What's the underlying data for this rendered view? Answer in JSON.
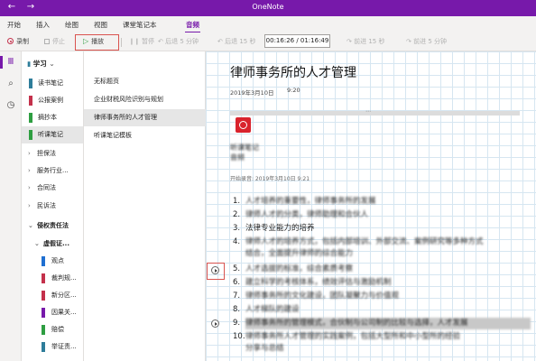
{
  "window": {
    "title": "OneNote",
    "back_glyph": "←",
    "forward_glyph": "→",
    "accent": "#7719aa"
  },
  "ribbon": {
    "tabs": [
      "开始",
      "插入",
      "绘图",
      "视图",
      "课堂笔记本",
      "音频"
    ],
    "active_tab": "音频"
  },
  "audio_bar": {
    "record": "录制",
    "stop": "停止",
    "play": "播放",
    "pause": "暂停",
    "rewind_5min": "后退 5 分钟",
    "rewind_15s": "后退 15 秒",
    "time": "00:16:26 / 01:16:49",
    "forward_15s": "前进 15 秒",
    "forward_5min": "前进 5 分钟"
  },
  "notebook": {
    "name": "学习",
    "sections": [
      {
        "label": "读书笔记",
        "color": "#2e7d9a"
      },
      {
        "label": "公报案例",
        "color": "#c4314b"
      },
      {
        "label": "摘抄本",
        "color": "#2e9e41"
      },
      {
        "label": "听课笔记",
        "color": "#2e9e41"
      }
    ],
    "groups_collapsed": [
      "担保法",
      "服务行业...",
      "合同法",
      "民诉法"
    ],
    "group_expanded": "侵权责任法",
    "subgroup": "虚假证...",
    "subsections": [
      {
        "label": "观点",
        "color": "#1f6fd1"
      },
      {
        "label": "裁判规...",
        "color": "#c4314b"
      },
      {
        "label": "新分区...",
        "color": "#c4314b"
      },
      {
        "label": "因果关...",
        "color": "#7719aa"
      },
      {
        "label": "赔偿",
        "color": "#2e9e41"
      },
      {
        "label": "举证责...",
        "color": "#2e7d9a"
      }
    ]
  },
  "pages": [
    "无标题页",
    "企业财税风险识别与规划",
    "律师事务所的人才管理",
    "听课笔记模板"
  ],
  "active_page_index": 2,
  "note": {
    "title": "律师事务所的人才管理",
    "date": "2019年3月10日",
    "time": "9:20",
    "scan_line1": "听课笔记",
    "scan_line2": "音频",
    "recording_start": "开始录音: 2019年3月10日 9:21",
    "items": [
      {
        "n": "1.",
        "text": "人才培养的重要性，律师事务所的发展"
      },
      {
        "n": "2.",
        "text": "律师人才的分类，律师助理和合伙人"
      },
      {
        "n": "3.",
        "text": "法律专业能力的培养"
      },
      {
        "n": "4.",
        "text": "律师人才的培养方式，包括内部培训、外部交流、案例研究等多种方式",
        "text2": "结合，全面提升律师的综合能力"
      },
      {
        "n": "5.",
        "text": "人才选拔的标准，综合素质考察"
      },
      {
        "n": "6.",
        "text": "建立科学的考核体系，绩效评估与激励机制"
      },
      {
        "n": "7.",
        "text": "律师事务所的文化建设，团队凝聚力与价值观"
      },
      {
        "n": "8.",
        "text": "人才梯队的建设"
      },
      {
        "n": "9.",
        "text": "律师事务所的管理模式，合伙制与公司制的比较与选择，人才发展"
      },
      {
        "n": "10.",
        "text": "律师事务所人才管理的实践案例，包括大型所和中小型所的经验",
        "text2": "分享与总结"
      }
    ]
  }
}
